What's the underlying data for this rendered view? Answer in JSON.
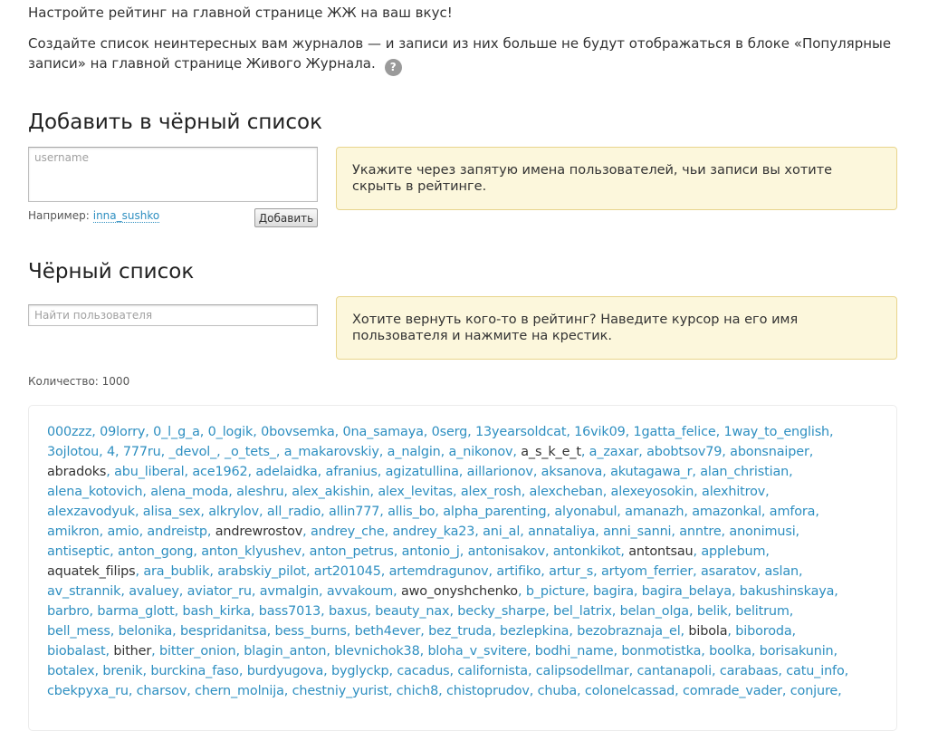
{
  "intro": {
    "line1": "Настройте рейтинг на главной странице ЖЖ на ваш вкус!",
    "line2": "Создайте список неинтересных вам журналов — и записи из них больше не будут отображаться в блоке «Популярные записи» на главной странице Живого Журнала.",
    "help_icon_label": "?"
  },
  "add_section": {
    "title": "Добавить в чёрный список",
    "placeholder": "username",
    "example_label": "Например:",
    "example_user": "inna_sushko",
    "button_label": "Добавить",
    "note": "Укажите через запятую имена пользователей, чьи записи вы хотите скрыть в рейтинге."
  },
  "list_section": {
    "title": "Чёрный список",
    "search_placeholder": "Найти пользователя",
    "note": "Хотите вернуть кого-то в рейтинг? Наведите курсор на его имя пользователя и нажмите на крестик.",
    "count_label": "Количество: 1000"
  },
  "colors": {
    "link": "#2e8fc1",
    "note_bg": "#fcf7dc",
    "note_border": "#e8d58c"
  },
  "users": [
    [
      "000zzz",
      "09lorry",
      "0_l_g_a",
      "0_logik",
      "0bovsemka",
      "0na_samaya",
      "0serg",
      "13yearsoldcat",
      "16vik09",
      "1gatta_felice",
      "1way_to_english"
    ],
    [
      "3ojlotou",
      "4",
      "777ru",
      "_devol_",
      "_o_tets_",
      "a_makarovskiy",
      "a_nalgin",
      "a_nikonov",
      "a_s_k_e_t",
      "a_zaxar",
      "abobtsov79",
      "abonsnaiper"
    ],
    [
      "abradoks",
      "abu_liberal",
      "ace1962",
      "adelaidka",
      "afranius",
      "agizatullina",
      "aillarionov",
      "aksanova",
      "akutagawa_r",
      "alan_christian"
    ],
    [
      "alena_kotovich",
      "alena_moda",
      "aleshru",
      "alex_akishin",
      "alex_levitas",
      "alex_rosh",
      "alexcheban",
      "alexeyosokin",
      "alexhitrov"
    ],
    [
      "alexzavodyuk",
      "alisa_sex",
      "alkrylov",
      "all_radio",
      "allin777",
      "allis_bo",
      "alpha_parenting",
      "alyonabul",
      "amanazh",
      "amazonkal",
      "amfora"
    ],
    [
      "amikron",
      "amio",
      "andreistp",
      "andrewrostov",
      "andrey_che",
      "andrey_ka23",
      "ani_al",
      "annataliya",
      "anni_sanni",
      "anntre",
      "anonimusi"
    ],
    [
      "antiseptic",
      "anton_gong",
      "anton_klyushev",
      "anton_petrus",
      "antonio_j",
      "antonisakov",
      "antonkikot",
      "antontsau",
      "applebum"
    ],
    [
      "aquatek_filips",
      "ara_bublik",
      "arabskiy_pilot",
      "art201045",
      "artemdragunov",
      "artifiko",
      "artur_s",
      "artyom_ferrier",
      "asaratov",
      "aslan"
    ],
    [
      "av_strannik",
      "avaluey",
      "aviator_ru",
      "avmalgin",
      "avvakoum",
      "awo_onyshchenko",
      "b_picture",
      "bagira",
      "bagira_belaya",
      "bakushinskaya"
    ],
    [
      "barbro",
      "barma_glott",
      "bash_kirka",
      "bass7013",
      "baxus",
      "beauty_nax",
      "becky_sharpe",
      "bel_latrix",
      "belan_olga",
      "belik",
      "belitrum"
    ],
    [
      "bell_mess",
      "belonika",
      "bespridanitsa",
      "bess_burns",
      "beth4ever",
      "bez_truda",
      "bezlepkina",
      "bezobraznaja_el",
      "bibola",
      "biboroda"
    ],
    [
      "biobalast",
      "bither",
      "bitter_onion",
      "blagin_anton",
      "blevnichok38",
      "bloha_v_svitere",
      "bodhi_name",
      "bonmotistka",
      "boolka",
      "borisakunin"
    ],
    [
      "botalex",
      "brenik",
      "burckina_faso",
      "burdyugova",
      "byglyckp",
      "cacadus",
      "californista",
      "calipsodellmar",
      "cantanapoli",
      "carabaas",
      "catu_info"
    ],
    [
      "cbekpyxa_ru",
      "charsov",
      "chern_molnija",
      "chestniy_yurist",
      "chich8",
      "chistoprudov",
      "chuba",
      "colonelcassad",
      "comrade_vader",
      "conjure"
    ]
  ],
  "plain_users": [
    "a_s_k_e_t",
    "abradoks",
    "andrewrostov",
    "antontsau",
    "aquatek_filips",
    "awo_onyshchenko",
    "bibola",
    "bither"
  ]
}
